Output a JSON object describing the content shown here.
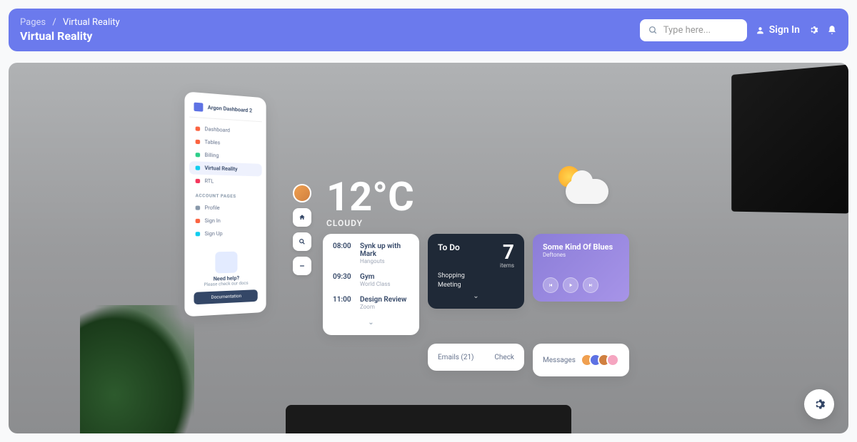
{
  "breadcrumb": {
    "root": "Pages",
    "current": "Virtual Reality"
  },
  "page_title": "Virtual Reality",
  "search": {
    "placeholder": "Type here..."
  },
  "signin_label": "Sign In",
  "sidebar": {
    "brand": "Argon Dashboard 2",
    "items": [
      {
        "label": "Dashboard"
      },
      {
        "label": "Tables"
      },
      {
        "label": "Billing"
      },
      {
        "label": "Virtual Reality"
      },
      {
        "label": "RTL"
      }
    ],
    "section": "ACCOUNT PAGES",
    "account_items": [
      {
        "label": "Profile"
      },
      {
        "label": "Sign In"
      },
      {
        "label": "Sign Up"
      }
    ],
    "help": {
      "title": "Need help?",
      "sub": "Please check our docs",
      "button": "Documentation"
    }
  },
  "weather": {
    "temp": "12°C",
    "condition": "CLOUDY"
  },
  "schedule": [
    {
      "time": "08:00",
      "title": "Synk up with Mark",
      "sub": "Hangouts"
    },
    {
      "time": "09:30",
      "title": "Gym",
      "sub": "World Class"
    },
    {
      "time": "11:00",
      "title": "Design Review",
      "sub": "Zoom"
    }
  ],
  "todo": {
    "title": "To Do",
    "count": "7",
    "items_label": "items",
    "sub": "Shopping\nMeeting"
  },
  "music": {
    "title": "Some Kind Of Blues",
    "artist": "Deftones"
  },
  "emails": {
    "label": "Emails (21)",
    "action": "Check"
  },
  "messages": {
    "label": "Messages"
  }
}
